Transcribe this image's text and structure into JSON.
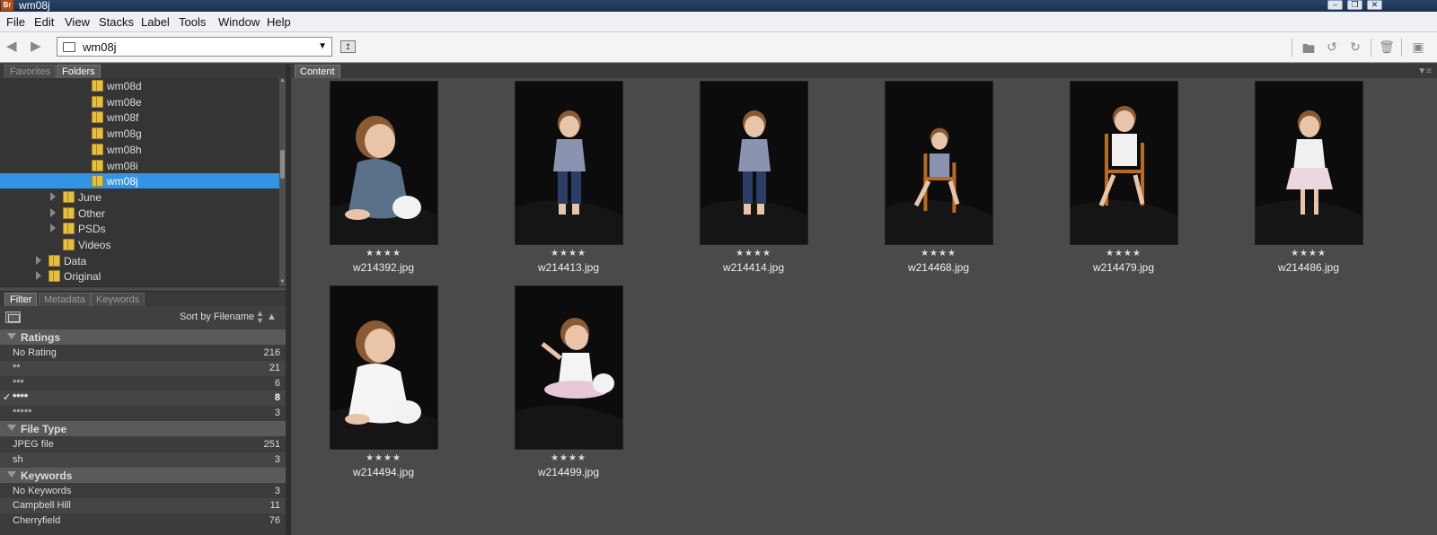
{
  "window": {
    "title": "wm08j",
    "app_icon": "Br"
  },
  "menu": [
    "File",
    "Edit",
    "View",
    "Stacks",
    "Label",
    "Tools",
    "Window",
    "Help"
  ],
  "path": {
    "current": "wm08j"
  },
  "left_tabs": [
    "Favorites",
    "Folders"
  ],
  "folder_tree": [
    {
      "label": "wm08d",
      "level": 2,
      "expander": false,
      "selected": false
    },
    {
      "label": "wm08e",
      "level": 2,
      "expander": false,
      "selected": false
    },
    {
      "label": "wm08f",
      "level": 2,
      "expander": false,
      "selected": false
    },
    {
      "label": "wm08g",
      "level": 2,
      "expander": false,
      "selected": false
    },
    {
      "label": "wm08h",
      "level": 2,
      "expander": false,
      "selected": false
    },
    {
      "label": "wm08i",
      "level": 2,
      "expander": false,
      "selected": false
    },
    {
      "label": "wm08j",
      "level": 2,
      "expander": false,
      "selected": true
    },
    {
      "label": "June",
      "level": 1,
      "expander": true,
      "selected": false
    },
    {
      "label": "Other",
      "level": 1,
      "expander": true,
      "selected": false
    },
    {
      "label": "PSDs",
      "level": 1,
      "expander": true,
      "selected": false
    },
    {
      "label": "Videos",
      "level": 1,
      "expander": false,
      "selected": false
    },
    {
      "label": "Data",
      "level": 0,
      "expander": true,
      "selected": false
    },
    {
      "label": "Original",
      "level": 0,
      "expander": true,
      "selected": false
    }
  ],
  "filter_tabs": [
    "Filter",
    "Metadata",
    "Keywords"
  ],
  "sort_label": "Sort by Filename",
  "filter_sections": [
    {
      "title": "Ratings",
      "rows": [
        {
          "label": "No Rating",
          "count": "216",
          "checked": false
        },
        {
          "label": "**",
          "count": "21",
          "checked": false
        },
        {
          "label": "***",
          "count": "6",
          "checked": false
        },
        {
          "label": "****",
          "count": "8",
          "checked": true
        },
        {
          "label": "*****",
          "count": "3",
          "checked": false
        }
      ]
    },
    {
      "title": "File Type",
      "rows": [
        {
          "label": "JPEG file",
          "count": "251",
          "checked": false
        },
        {
          "label": "sh",
          "count": "3",
          "checked": false
        }
      ]
    },
    {
      "title": "Keywords",
      "rows": [
        {
          "label": "No Keywords",
          "count": "3",
          "checked": false
        },
        {
          "label": "Campbell Hill",
          "count": "11",
          "checked": false
        },
        {
          "label": "Cherryfield",
          "count": "76",
          "checked": false
        }
      ]
    }
  ],
  "content_tab": "Content",
  "thumbnails": [
    {
      "filename": "w214392.jpg",
      "stars": "★★★★",
      "pose": "sit-bunny",
      "dress": "#5a7088"
    },
    {
      "filename": "w214413.jpg",
      "stars": "★★★★",
      "pose": "stand",
      "dress": "#8a94b0"
    },
    {
      "filename": "w214414.jpg",
      "stars": "★★★★",
      "pose": "stand",
      "dress": "#8a94b0"
    },
    {
      "filename": "w214468.jpg",
      "stars": "★★★★",
      "pose": "chair-small",
      "dress": "#8a94b0"
    },
    {
      "filename": "w214479.jpg",
      "stars": "★★★★",
      "pose": "chair",
      "dress": "#f0f0f0"
    },
    {
      "filename": "w214486.jpg",
      "stars": "★★★★",
      "pose": "stand-dress",
      "dress": "#f0f0f0"
    },
    {
      "filename": "w214494.jpg",
      "stars": "★★★★",
      "pose": "sit-bunny",
      "dress": "#f4f4f4"
    },
    {
      "filename": "w214499.jpg",
      "stars": "★★★★",
      "pose": "sit-point",
      "dress": "#f4f4f4"
    }
  ]
}
